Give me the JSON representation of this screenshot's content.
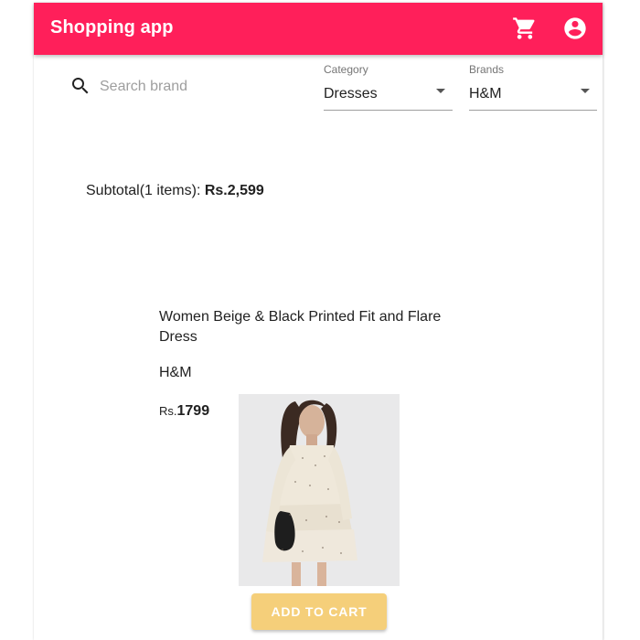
{
  "appbar": {
    "title": "Shopping app",
    "icons": [
      "cart-icon",
      "account-circle-icon"
    ],
    "color": "#ff1f5a"
  },
  "filters": {
    "search": {
      "placeholder": "Search brand",
      "value": ""
    },
    "category": {
      "label": "Category",
      "value": "Dresses"
    },
    "brands": {
      "label": "Brands",
      "value": "H&M"
    }
  },
  "subtotal": {
    "prefix": "Subtotal(1 items): ",
    "amount": "Rs.2,599"
  },
  "product": {
    "title": "Women Beige & Black Printed Fit and Flare Dress",
    "brand": "H&M",
    "currency": "Rs.",
    "price": "1799",
    "image_icon": "product-photo",
    "add_to_cart_label": "ADD TO CART",
    "add_to_cart_color": "#f5cf7a"
  }
}
